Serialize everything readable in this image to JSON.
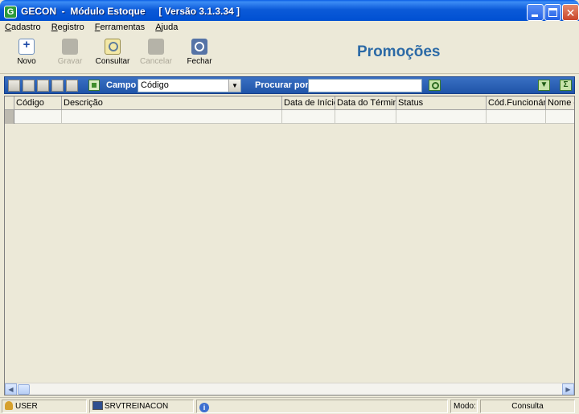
{
  "window": {
    "icon_letter": "G",
    "title": "GECON  -  Módulo Estoque     [ Versão 3.1.3.34 ]"
  },
  "menu": [
    "Cadastro",
    "Registro",
    "Ferramentas",
    "Ajuda"
  ],
  "toolbar": {
    "novo": "Novo",
    "gravar": "Gravar",
    "consultar": "Consultar",
    "cancelar": "Cancelar",
    "fechar": "Fechar"
  },
  "page_title": "Promoções",
  "search": {
    "campo_label": "Campo",
    "campo_value": "Código",
    "procurar_label": "Procurar por",
    "procurar_value": ""
  },
  "grid": {
    "columns": [
      "Código",
      "Descrição",
      "Data de Início",
      "Data do Término",
      "Status",
      "Cód.Funcionário",
      "Nome d"
    ]
  },
  "status": {
    "user": "USER",
    "server": "SRVTREINACON",
    "modo_label": "Modo:",
    "modo_value": "Consulta"
  },
  "colors": {
    "title_blue": "#0050d2",
    "search_bar_blue": "#2a5fb5",
    "heading_blue": "#2c6aa6"
  }
}
